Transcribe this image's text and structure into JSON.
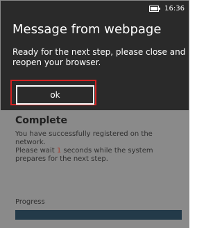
{
  "status_bar": {
    "time": "16:36",
    "icon": "battery-icon"
  },
  "dialog": {
    "title": "Message from webpage",
    "message_lines": [
      "Ready for the next step, please close and",
      "reopen your browser."
    ],
    "ok_label": "ok"
  },
  "background_page": {
    "title": "Complete",
    "text_line1": "You have successfully registered on the",
    "text_line2": "network.",
    "text_line3_pre": "Please wait ",
    "seconds": "1",
    "text_line3_post": " seconds while the system",
    "text_line4": "prepares for the next step.",
    "progress_label": "Progress",
    "progress_value": 1.0
  },
  "colors": {
    "dialog_bg": "#2a2a2a",
    "highlight_border": "#d32121",
    "countdown": "#a83a2a"
  }
}
